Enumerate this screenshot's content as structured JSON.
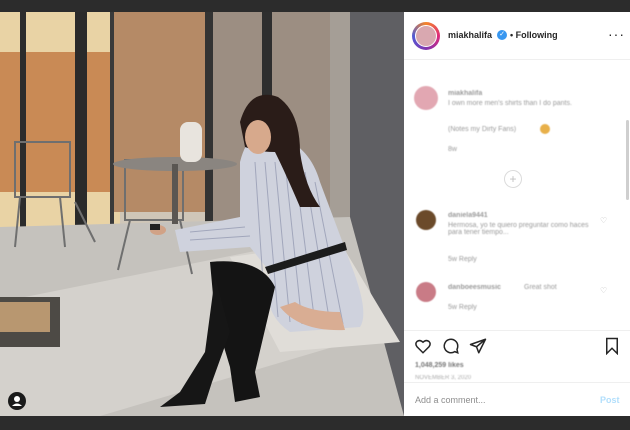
{
  "post": {
    "username": "miakhalifa",
    "follow_status": "Following",
    "verified_mark": "✓"
  },
  "comments": {
    "caption_user": "miakhalifa",
    "caption_text": "I own more men's shirts than I do pants.",
    "caption_sub": "(Notes my Dirty Fans)",
    "caption_meta": "8w",
    "items": [
      {
        "user": "daniela9441",
        "text": "Hermosa, yo te quiero preguntar como haces para tener tiempo...",
        "meta": "5w   Reply"
      },
      {
        "user": "danboeesmusic",
        "text": "Great shot",
        "meta": "5w   Reply"
      }
    ]
  },
  "actions": {
    "likes": "1,048,259 likes",
    "date": "NOVEMBER 3, 2020"
  },
  "composer": {
    "placeholder": "Add a comment...",
    "post_label": "Post"
  },
  "icons": {
    "like": "heart-icon",
    "comment": "comment-icon",
    "share": "share-icon",
    "save": "bookmark-icon",
    "more": "more-options-icon",
    "user_tag": "user-tag-icon"
  }
}
